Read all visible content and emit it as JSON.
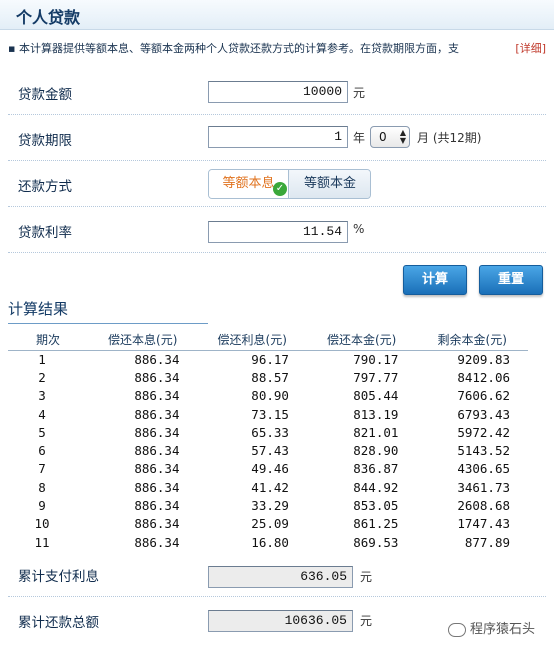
{
  "header": {
    "title": "个人贷款"
  },
  "desc": {
    "bullet": "▪",
    "text": "本计算器提供等额本息、等额本金两种个人贷款还款方式的计算参考。在贷款期限方面，支",
    "detail": "[详细]"
  },
  "form": {
    "amount": {
      "label": "贷款金额",
      "value": "10000",
      "unit": "元"
    },
    "term": {
      "label": "贷款期限",
      "years": "1",
      "year_unit": "年",
      "months": "0",
      "month_unit": "月 (共12期)"
    },
    "method": {
      "label": "还款方式",
      "options": [
        "等额本息",
        "等额本金"
      ],
      "selected": "等额本息"
    },
    "rate": {
      "label": "贷款利率",
      "value": "11.54",
      "unit": "%"
    }
  },
  "buttons": {
    "calc": "计算",
    "reset": "重置"
  },
  "results": {
    "title": "计算结果",
    "columns": [
      "期次",
      "偿还本息(元)",
      "偿还利息(元)",
      "偿还本金(元)",
      "剩余本金(元)"
    ],
    "rows": [
      [
        "1",
        "886.34",
        "96.17",
        "790.17",
        "9209.83"
      ],
      [
        "2",
        "886.34",
        "88.57",
        "797.77",
        "8412.06"
      ],
      [
        "3",
        "886.34",
        "80.90",
        "805.44",
        "7606.62"
      ],
      [
        "4",
        "886.34",
        "73.15",
        "813.19",
        "6793.43"
      ],
      [
        "5",
        "886.34",
        "65.33",
        "821.01",
        "5972.42"
      ],
      [
        "6",
        "886.34",
        "57.43",
        "828.90",
        "5143.52"
      ],
      [
        "7",
        "886.34",
        "49.46",
        "836.87",
        "4306.65"
      ],
      [
        "8",
        "886.34",
        "41.42",
        "844.92",
        "3461.73"
      ],
      [
        "9",
        "886.34",
        "33.29",
        "853.05",
        "2608.68"
      ],
      [
        "10",
        "886.34",
        "25.09",
        "861.25",
        "1747.43"
      ],
      [
        "11",
        "886.34",
        "16.80",
        "869.53",
        "877.89"
      ]
    ]
  },
  "summary": {
    "interest": {
      "label": "累计支付利息",
      "value": "636.05",
      "unit": "元"
    },
    "total": {
      "label": "累计还款总额",
      "value": "10636.05",
      "unit": "元"
    }
  },
  "watermark": {
    "text": "程序猿石头"
  },
  "colors": {
    "accent": "#e0731f",
    "button": "#1a6fb8",
    "header": "#143b66"
  }
}
